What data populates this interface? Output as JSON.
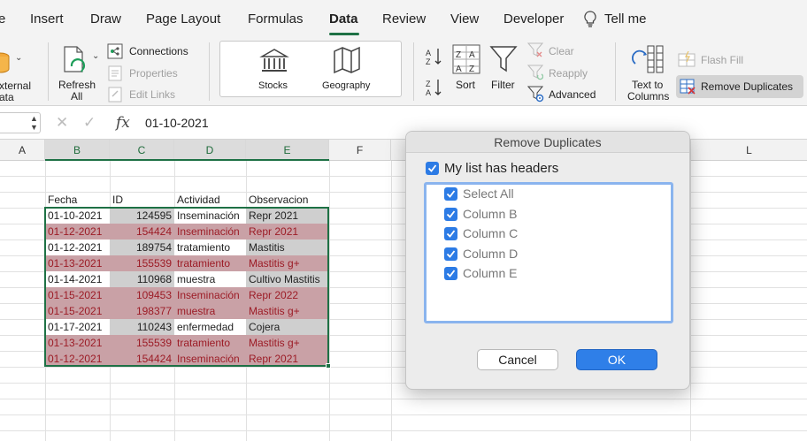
{
  "tabs": [
    {
      "id": "tab-home-partial",
      "label": "e"
    },
    {
      "id": "tab-insert",
      "label": "Insert"
    },
    {
      "id": "tab-draw",
      "label": "Draw"
    },
    {
      "id": "tab-page-layout",
      "label": "Page Layout"
    },
    {
      "id": "tab-formulas",
      "label": "Formulas"
    },
    {
      "id": "tab-data",
      "label": "Data",
      "active": true
    },
    {
      "id": "tab-review",
      "label": "Review"
    },
    {
      "id": "tab-view",
      "label": "View"
    },
    {
      "id": "tab-developer",
      "label": "Developer"
    },
    {
      "id": "tab-tell-me",
      "label": "Tell me"
    }
  ],
  "ribbon": {
    "external_data_line1": "xternal",
    "external_data_line2": "ata",
    "refresh_all_line1": "Refresh",
    "refresh_all_line2": "All",
    "connections": "Connections",
    "properties": "Properties",
    "edit_links": "Edit Links",
    "stocks": "Stocks",
    "geography": "Geography",
    "sort": "Sort",
    "filter": "Filter",
    "clear": "Clear",
    "reapply": "Reapply",
    "advanced": "Advanced",
    "text_to_columns_line1": "Text to",
    "text_to_columns_line2": "Columns",
    "flash_fill": "Flash Fill",
    "remove_duplicates": "Remove Duplicates"
  },
  "formula_bar": {
    "fx": "fx",
    "value": "01-10-2021"
  },
  "sheet": {
    "columns": [
      "A",
      "B",
      "C",
      "D",
      "E",
      "F",
      "L"
    ],
    "header_row": [
      "Fecha",
      "ID",
      "Actividad",
      "Observacion"
    ],
    "rows": [
      {
        "fecha": "01-10-2021",
        "id": "124595",
        "actividad": "Inseminación",
        "observacion": "Repr 2021",
        "dup": false
      },
      {
        "fecha": "01-12-2021",
        "id": "154424",
        "actividad": "Inseminación",
        "observacion": "Repr 2021",
        "dup": true
      },
      {
        "fecha": "01-12-2021",
        "id": "189754",
        "actividad": "tratamiento",
        "observacion": "Mastitis",
        "dup": false
      },
      {
        "fecha": "01-13-2021",
        "id": "155539",
        "actividad": "tratamiento",
        "observacion": "Mastitis g+",
        "dup": true
      },
      {
        "fecha": "01-14-2021",
        "id": "110968",
        "actividad": "muestra",
        "observacion": "Cultivo Mastitis",
        "dup": false
      },
      {
        "fecha": "01-15-2021",
        "id": "109453",
        "actividad": "Inseminación",
        "observacion": "Repr 2022",
        "dup": true
      },
      {
        "fecha": "01-15-2021",
        "id": "198377",
        "actividad": "muestra",
        "observacion": "Mastitis g+",
        "dup": true
      },
      {
        "fecha": "01-17-2021",
        "id": "110243",
        "actividad": "enfermedad",
        "observacion": "Cojera",
        "dup": false
      },
      {
        "fecha": "01-13-2021",
        "id": "155539",
        "actividad": "tratamiento",
        "observacion": "Mastitis g+",
        "dup": true
      },
      {
        "fecha": "01-12-2021",
        "id": "154424",
        "actividad": "Inseminación",
        "observacion": "Repr 2021",
        "dup": true
      }
    ]
  },
  "dialog": {
    "title": "Remove Duplicates",
    "headers_checkbox": "My list has headers",
    "headers_checked": true,
    "items": [
      {
        "label": "Select All",
        "checked": true
      },
      {
        "label": "Column B",
        "checked": true
      },
      {
        "label": "Column C",
        "checked": true
      },
      {
        "label": "Column D",
        "checked": true
      },
      {
        "label": "Column E",
        "checked": true
      }
    ],
    "cancel": "Cancel",
    "ok": "OK"
  },
  "colors": {
    "accent_green": "#1e7145",
    "dup_fill": "#c9a1a6",
    "dup_text": "#9c1c26",
    "grey_fill": "#cfcfcf",
    "checkbox_blue": "#2c7be5",
    "ok_blue": "#2f7fe8"
  }
}
